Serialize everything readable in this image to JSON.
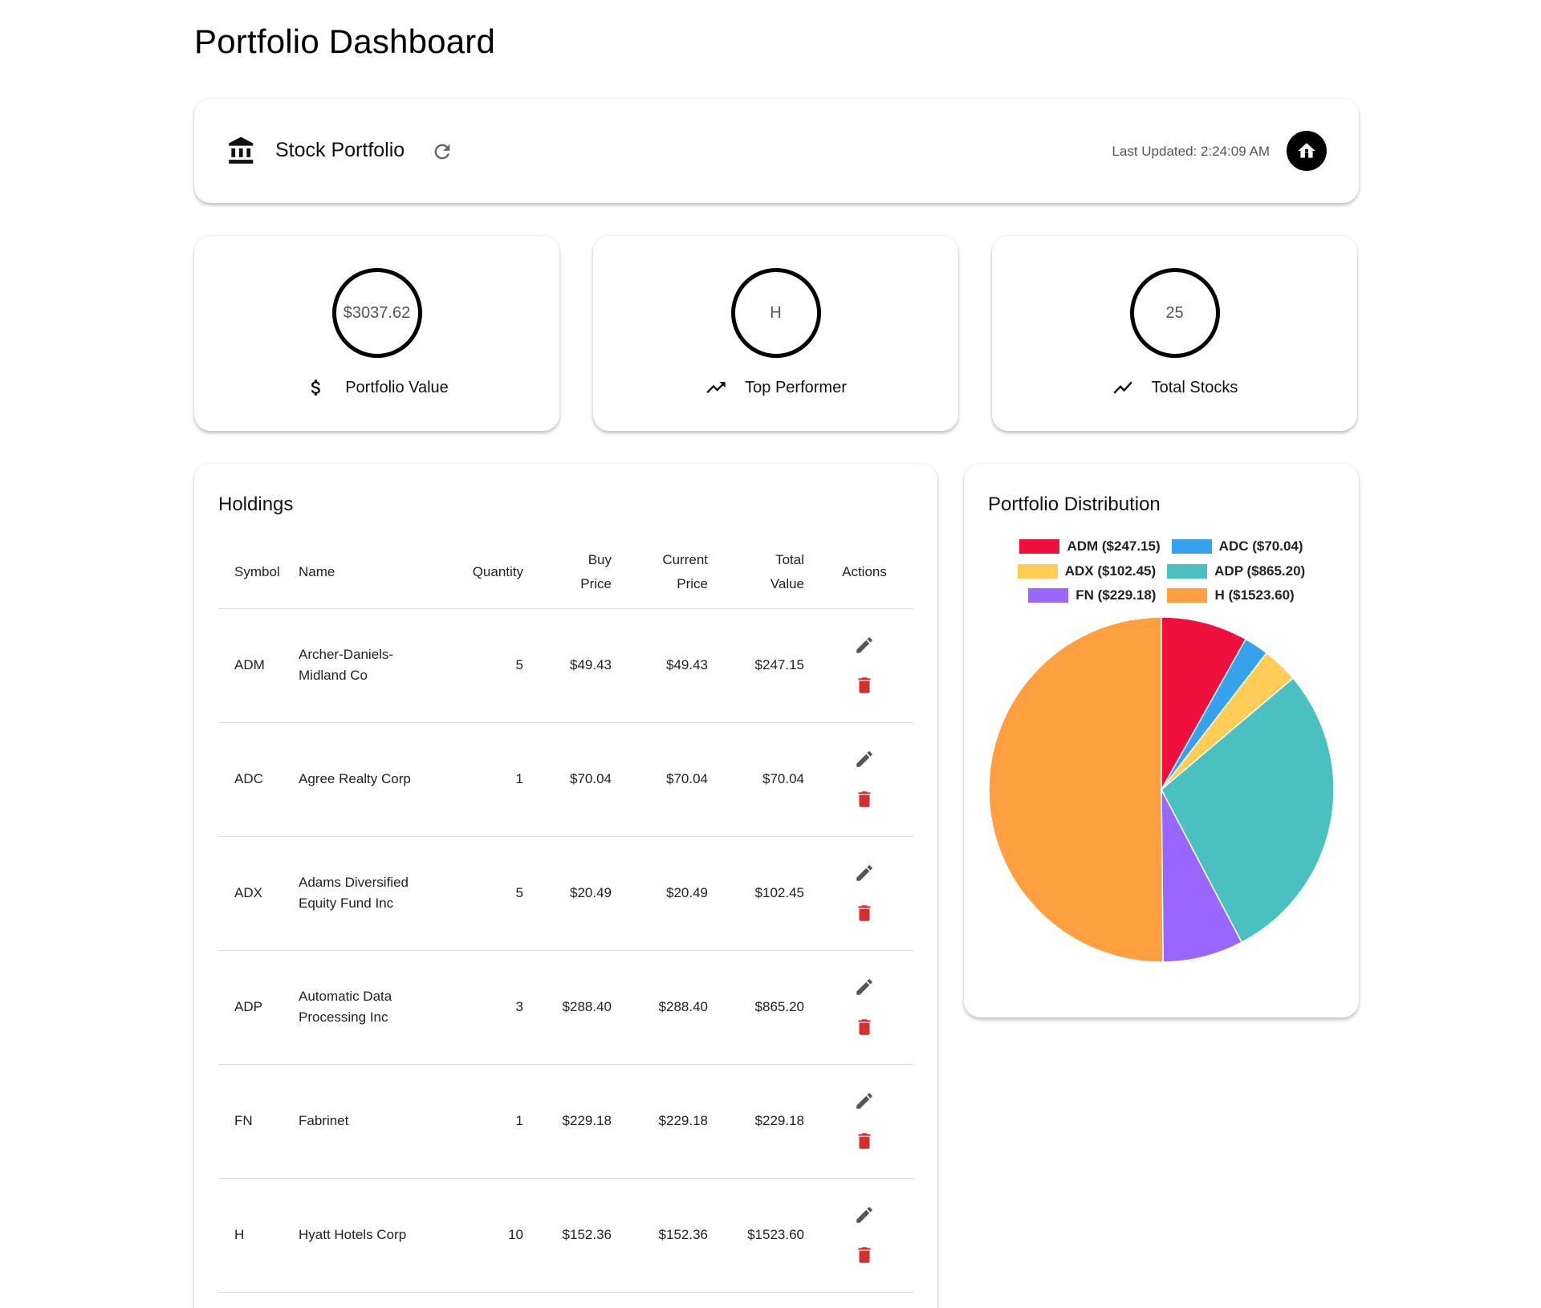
{
  "page": {
    "title": "Portfolio Dashboard"
  },
  "header": {
    "portfolio_name": "Stock Portfolio",
    "last_updated": "Last Updated: 2:24:09 AM",
    "icons": {
      "bank": "bank-icon",
      "refresh": "refresh-icon",
      "home": "home-icon"
    }
  },
  "stats": [
    {
      "value": "$3037.62",
      "label": "Portfolio Value",
      "icon": "dollar-icon"
    },
    {
      "value": "H",
      "label": "Top Performer",
      "icon": "trending-up-icon"
    },
    {
      "value": "25",
      "label": "Total Stocks",
      "icon": "show-chart-icon"
    }
  ],
  "holdings": {
    "title": "Holdings",
    "columns": {
      "symbol": "Symbol",
      "name": "Name",
      "quantity": "Quantity",
      "buy_price": [
        "Buy",
        "Price"
      ],
      "current_price": [
        "Current",
        "Price"
      ],
      "total_value": [
        "Total",
        "Value"
      ],
      "actions": "Actions"
    },
    "rows": [
      {
        "symbol": "ADM",
        "name": "Archer-Daniels-Midland Co",
        "quantity": "5",
        "buy_price": "$49.43",
        "current_price": "$49.43",
        "total_value": "$247.15"
      },
      {
        "symbol": "ADC",
        "name": "Agree Realty Corp",
        "quantity": "1",
        "buy_price": "$70.04",
        "current_price": "$70.04",
        "total_value": "$70.04"
      },
      {
        "symbol": "ADX",
        "name": "Adams Diversified Equity Fund Inc",
        "quantity": "5",
        "buy_price": "$20.49",
        "current_price": "$20.49",
        "total_value": "$102.45"
      },
      {
        "symbol": "ADP",
        "name": "Automatic Data Processing Inc",
        "quantity": "3",
        "buy_price": "$288.40",
        "current_price": "$288.40",
        "total_value": "$865.20"
      },
      {
        "symbol": "FN",
        "name": "Fabrinet",
        "quantity": "1",
        "buy_price": "$229.18",
        "current_price": "$229.18",
        "total_value": "$229.18"
      },
      {
        "symbol": "H",
        "name": "Hyatt Hotels Corp",
        "quantity": "10",
        "buy_price": "$152.36",
        "current_price": "$152.36",
        "total_value": "$1523.60"
      }
    ],
    "icons": {
      "edit": "edit-icon",
      "delete": "delete-icon"
    }
  },
  "distribution": {
    "title": "Portfolio Distribution",
    "legend_rows": [
      [
        0,
        1
      ],
      [
        2,
        3
      ],
      [
        4,
        5
      ]
    ]
  },
  "chart_data": {
    "type": "pie",
    "title": "",
    "labels": [
      "ADM ($247.15)",
      "ADC ($70.04)",
      "ADX ($102.45)",
      "ADP ($865.20)",
      "FN ($229.18)",
      "H ($1523.60)"
    ],
    "categories": [
      "ADM",
      "ADC",
      "ADX",
      "ADP",
      "FN",
      "H"
    ],
    "values": [
      247.15,
      70.04,
      102.45,
      865.2,
      229.18,
      1523.6
    ],
    "colors": [
      "#f0103d",
      "#36a2eb",
      "#ffcd56",
      "#4bc0c0",
      "#9966ff",
      "#ff9f40"
    ],
    "legend_position": "top"
  },
  "colors": {
    "delete": "#d32f2f",
    "edit": "#555555",
    "accent": "#000000"
  }
}
